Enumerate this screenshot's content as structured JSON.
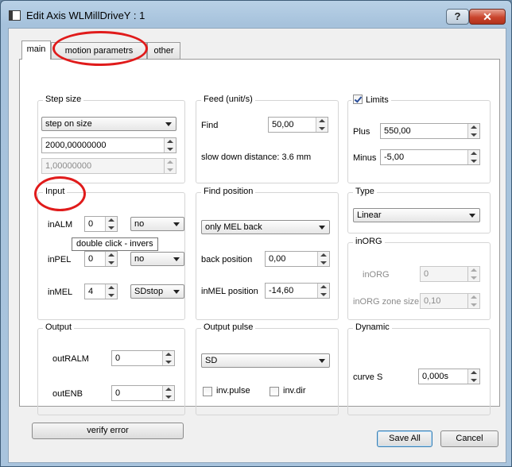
{
  "window": {
    "title": "Edit Axis  WLMillDriveY : 1"
  },
  "tabs": [
    {
      "label": "main",
      "active": true
    },
    {
      "label": "motion parametrs",
      "active": false
    },
    {
      "label": "other",
      "active": false
    }
  ],
  "step_size": {
    "title": "Step size",
    "mode": "step on size",
    "value": "2000,00000000",
    "value2": "1,00000000"
  },
  "feed": {
    "title": "Feed (unit/s)",
    "find_label": "Find",
    "find_value": "50,00",
    "slow_down": "slow down distance: 3.6 mm"
  },
  "limits": {
    "title": "Limits",
    "checked": true,
    "plus_label": "Plus",
    "plus_value": "550,00",
    "minus_label": "Minus",
    "minus_value": "-5,00"
  },
  "input": {
    "title": "Input",
    "inalm_label": "inALM",
    "inalm_value": "0",
    "inalm_mode": "no",
    "tooltip": "double click - invers",
    "inpel_label": "inPEL",
    "inpel_value": "0",
    "inpel_mode": "no",
    "inmel_label": "inMEL",
    "inmel_value": "4",
    "inmel_mode": "SDstop"
  },
  "find_position": {
    "title": "Find position",
    "mode": "only MEL back",
    "back_label": "back position",
    "back_value": "0,00",
    "inmel_label": "inMEL position",
    "inmel_value": "-14,60"
  },
  "type": {
    "title": "Type",
    "value": "Linear"
  },
  "inorg": {
    "title": "inORG",
    "inorg_label": "inORG",
    "inorg_value": "0",
    "zone_label": "inORG zone size",
    "zone_value": "0,10"
  },
  "output": {
    "title": "Output",
    "outralm_label": "outRALM",
    "outralm_value": "0",
    "outenb_label": "outENB",
    "outenb_value": "0"
  },
  "output_pulse": {
    "title": "Output pulse",
    "mode": "SD",
    "inv_pulse_label": "inv.pulse",
    "inv_dir_label": "inv.dir"
  },
  "dynamic": {
    "title": "Dynamic",
    "curve_label": "curve S",
    "curve_value": "0,000s"
  },
  "buttons": {
    "verify": "verify error",
    "save_all": "Save All",
    "cancel": "Cancel"
  },
  "colors": {
    "annotation": "#e01b1b",
    "titlebar": "#a6c2dc"
  },
  "icons": {
    "help": "?",
    "close": "✕"
  }
}
